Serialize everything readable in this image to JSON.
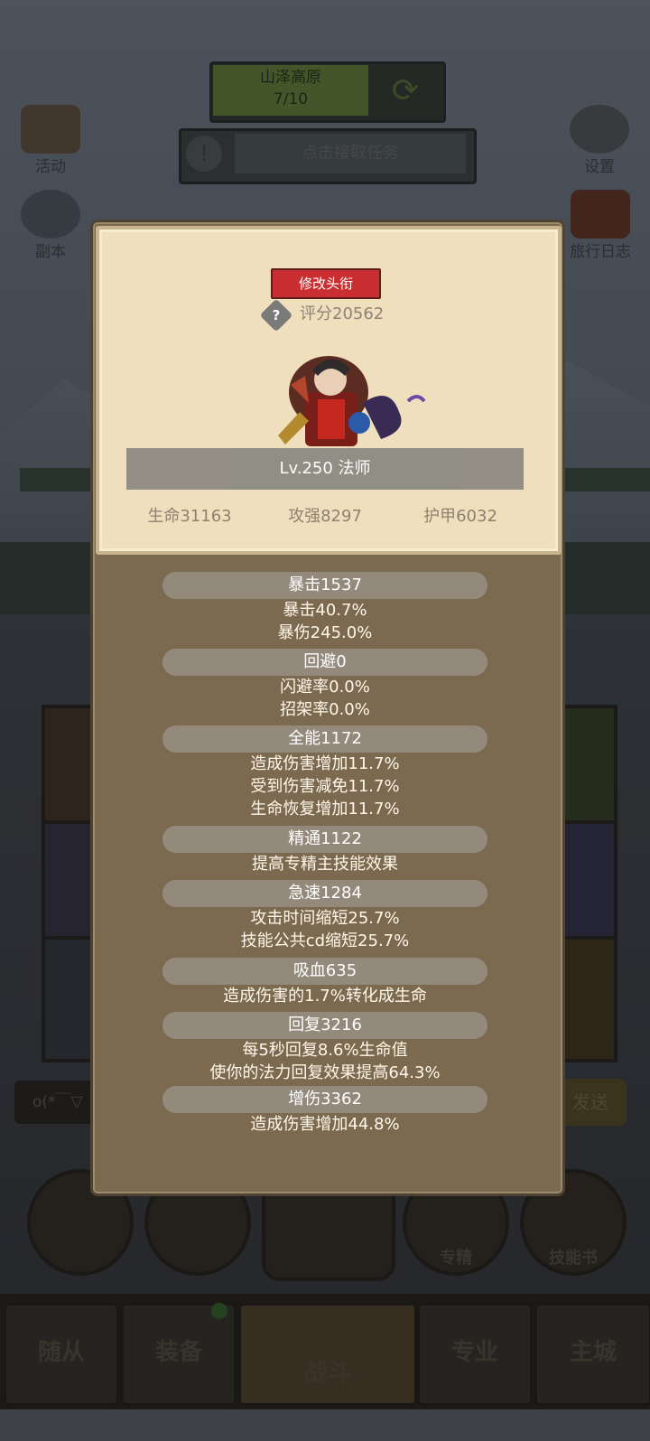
{
  "background": {
    "region": {
      "name": "山泽高原",
      "progress": "7/10"
    },
    "quest_button": "点击接取任务",
    "left_buttons": [
      "活动",
      "副本"
    ],
    "right_buttons": [
      "设置",
      "旅行日志"
    ],
    "chat_placeholder": "o(*￣▽",
    "send_label": "发送",
    "round_buttons": [
      "专精",
      "技能书"
    ],
    "nav_tabs": [
      "随从",
      "装备",
      "战斗",
      "专业",
      "主城"
    ]
  },
  "popup": {
    "rename_label": "修改头衔",
    "score": "评分20562",
    "level_class": "Lv.250 法师",
    "basic_stats": [
      "生命31163",
      "攻强8297",
      "护甲6032"
    ],
    "stats": [
      {
        "title": "暴击1537",
        "lines": [
          "暴击40.7%",
          "暴伤245.0%"
        ]
      },
      {
        "title": "回避0",
        "lines": [
          "闪避率0.0%",
          "招架率0.0%"
        ]
      },
      {
        "title": "全能1172",
        "lines": [
          "造成伤害增加11.7%",
          "受到伤害减免11.7%",
          "生命恢复增加11.7%"
        ]
      },
      {
        "title": "精通1122",
        "lines": [
          "提高专精主技能效果"
        ]
      },
      {
        "title": "急速1284",
        "lines": [
          "攻击时间缩短25.7%",
          "技能公共cd缩短25.7%"
        ]
      },
      {
        "title": "吸血635",
        "lines": [
          "造成伤害的1.7%转化成生命"
        ]
      },
      {
        "title": "回复3216",
        "lines": [
          "每5秒回复8.6%生命值",
          "使你的法力回复效果提高64.3%"
        ]
      },
      {
        "title": "增伤3362",
        "lines": [
          "造成伤害增加44.8%"
        ]
      }
    ]
  },
  "colors": {
    "rename_button": "#c92f30",
    "popup_bg": "#7c6a50",
    "card_bg": "#efdfbd"
  }
}
